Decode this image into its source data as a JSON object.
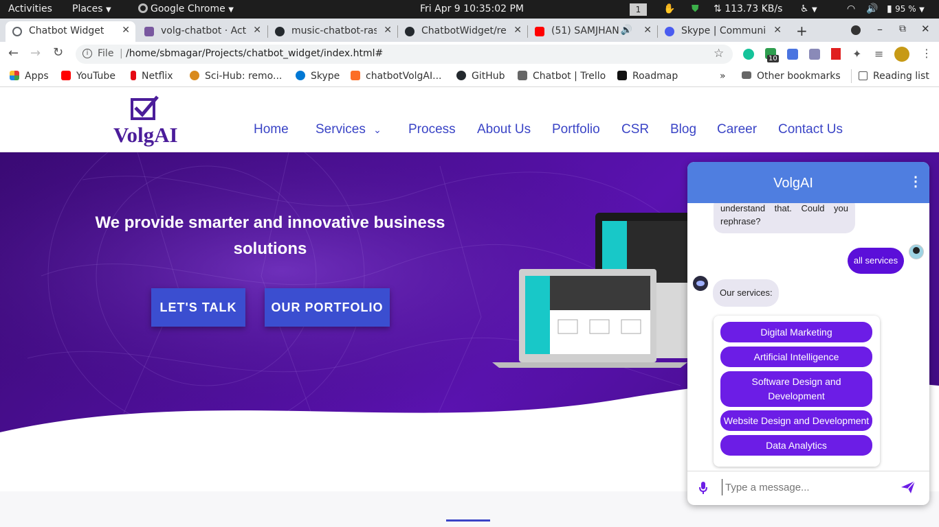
{
  "os": {
    "activities": "Activities",
    "places": "Places",
    "app_menu": "Google Chrome",
    "datetime": "Fri Apr 9  10:35:02 PM",
    "workspace": "1",
    "network_speed": "113.73 KB/s",
    "battery": "95 %"
  },
  "tabs": [
    {
      "title": "Chatbot Widget",
      "active": true,
      "icon": "globe-icon",
      "color": "#5f6368"
    },
    {
      "title": "volg-chatbot · Acti",
      "icon": "heroku-icon",
      "color": "#79589f"
    },
    {
      "title": "music-chatbot-ras",
      "icon": "github-icon",
      "color": "#24292e"
    },
    {
      "title": "ChatbotWidget/re",
      "icon": "github-icon",
      "color": "#24292e"
    },
    {
      "title": "(51) SAMJHAN",
      "icon": "youtube-icon",
      "color": "#ff0000"
    },
    {
      "title": "Skype | Communic",
      "icon": "skype-icon",
      "color": "#4a5cf0"
    }
  ],
  "address": {
    "scheme_label": "File",
    "url": "/home/sbmagar/Projects/chatbot_widget/index.html#"
  },
  "extensions": {
    "badge_count": "10"
  },
  "bookmarks": [
    {
      "label": "Apps",
      "icon": "apps-grid-icon",
      "color": "#e53935"
    },
    {
      "label": "YouTube",
      "icon": "youtube-icon",
      "color": "#ff0000"
    },
    {
      "label": "Netflix",
      "icon": "netflix-icon",
      "color": "#e50914"
    },
    {
      "label": "Sci-Hub: remo...",
      "icon": "scihub-icon",
      "color": "#d98a1c"
    },
    {
      "label": "Skype",
      "icon": "skype-icon",
      "color": "#0078d4"
    },
    {
      "label": "chatbotVolgAI...",
      "icon": "gitlab-icon",
      "color": "#fc6d26"
    },
    {
      "label": "GitHub",
      "icon": "github-icon",
      "color": "#24292e"
    },
    {
      "label": "Chatbot | Trello",
      "icon": "trello-icon",
      "color": "#666666"
    },
    {
      "label": "Roadmap",
      "icon": "roadmap-icon",
      "color": "#111111"
    }
  ],
  "bookmarks_right": {
    "more": "»",
    "other": "Other bookmarks",
    "reading": "Reading list"
  },
  "site": {
    "logo_text": "VolgAI",
    "nav": [
      "Home",
      "Services",
      "Process",
      "About Us",
      "Portfolio",
      "CSR",
      "Blog",
      "Career",
      "Contact Us"
    ],
    "hero_title": "We provide smarter and innovative business solutions",
    "buttons": {
      "talk": "LET'S TALK",
      "portfolio": "OUR PORTFOLIO"
    },
    "colors": {
      "brand_purple": "#4b1d9a",
      "nav_blue": "#3a44c6",
      "button_blue": "#3b4ed0"
    }
  },
  "chat": {
    "title": "VolgAI",
    "partial_bot_msg": "understand that. Could you rephrase?",
    "user_msg": "all services",
    "bot_msg": "Our services:",
    "quick_replies": [
      "Digital Marketing",
      "Artificial Intelligence",
      "Software Design and Development",
      "Website Design and Development",
      "Data Analytics"
    ],
    "placeholder": "Type a message...",
    "colors": {
      "header": "#4f7ee0",
      "user_bubble": "#5b0fd9",
      "quick_reply": "#6c1de6"
    }
  }
}
